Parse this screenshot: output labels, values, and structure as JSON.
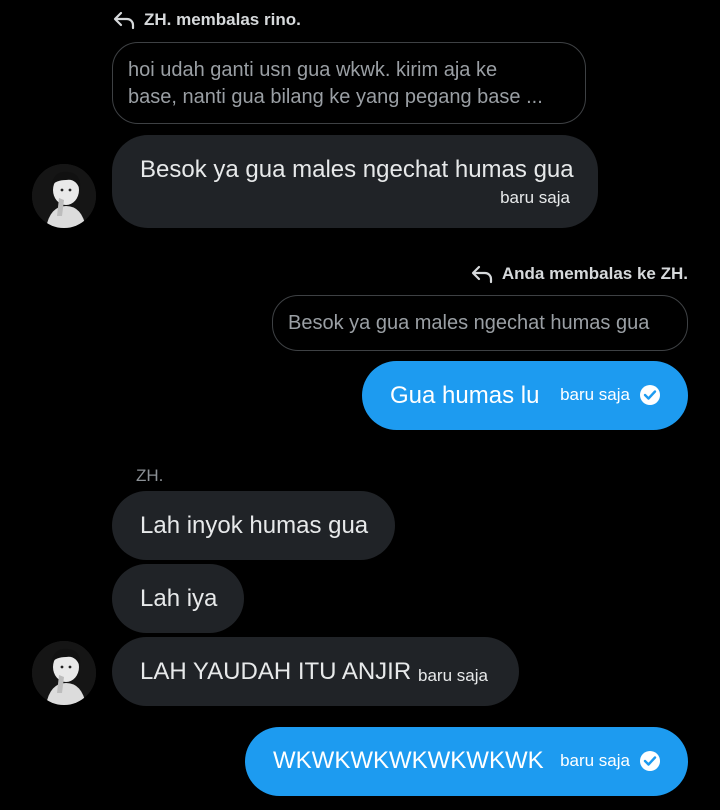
{
  "thread": {
    "reply1": {
      "label": "ZH. membalas rino.",
      "quote_line1": "hoi udah ganti usn gua wkwk. kirim aja ke",
      "quote_line2": "base, nanti gua bilang ke yang pegang base ..."
    },
    "msg1": {
      "text": "Besok ya gua males ngechat humas gua",
      "time": "baru saja"
    },
    "reply2": {
      "label": "Anda membalas ke ZH.",
      "quote": "Besok ya gua males ngechat humas gua"
    },
    "msg2": {
      "text": "Gua humas lu",
      "time": "baru saja"
    },
    "sender": "ZH.",
    "msg3": {
      "text": "Lah inyok humas gua"
    },
    "msg4": {
      "text": "Lah iya"
    },
    "msg5": {
      "text": "LAH YAUDAH ITU ANJIR",
      "time": "baru saja"
    },
    "msg6": {
      "text": "WKWKWKWKWKWKWK",
      "time": "baru saja"
    }
  },
  "colors": {
    "background": "#000000",
    "received_bubble": "#202327",
    "sent_bubble": "#1d9bf0",
    "quote_border": "#3e4144"
  },
  "icons": [
    "reply-arrow-icon",
    "read-check-icon",
    "avatar"
  ]
}
